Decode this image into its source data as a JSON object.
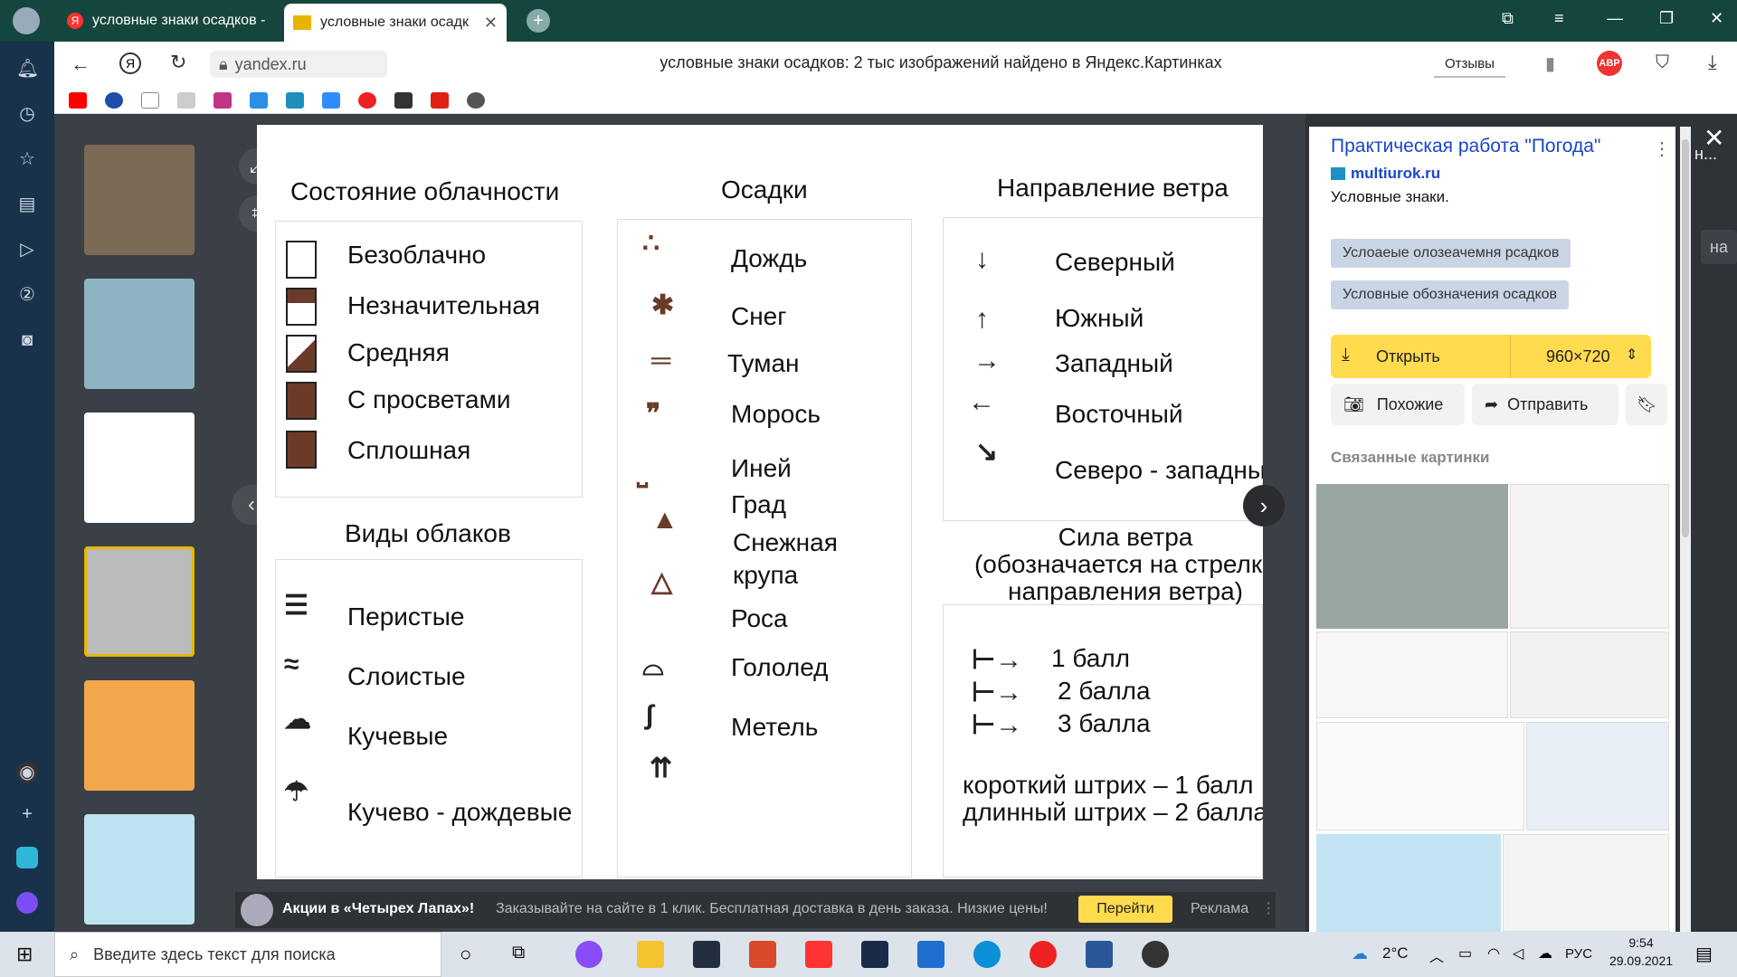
{
  "tabs": [
    {
      "label": "условные знаки осадков -"
    },
    {
      "label": "условные знаки осадк"
    }
  ],
  "address": {
    "domain": "yandex.ru",
    "page_title": "условные знаки осадков: 2 тыс изображений найдено в Яндекс.Картинках",
    "reviews": "Отзывы",
    "abp": "ABP"
  },
  "image": {
    "headings": {
      "clouds_state": "Состояние облачности",
      "precip": "Осадки",
      "wind_dir": "Направление ветра",
      "cloud_types": "Виды облаков",
      "wind_force": "Сила ветра",
      "wind_force_note1": "(обозначается на стрелке",
      "wind_force_note2": "направления ветра)"
    },
    "cloud_state": [
      "Безоблачно",
      "Незначительная",
      "Средняя",
      "С просветами",
      "Сплошная"
    ],
    "precip": [
      "Дождь",
      "Снег",
      "Туман",
      "Морось",
      "Иней",
      "Град",
      "Снежная",
      "крупа",
      "Роса",
      "Гололед",
      "Метель"
    ],
    "wind_dir": [
      "Северный",
      "Южный",
      "Западный",
      "Восточный",
      "Северо - западный"
    ],
    "cloud_types": [
      "Перистые",
      "Слоистые",
      "Кучевые",
      "Кучево - дождевые"
    ],
    "force": [
      "1 балл",
      "2 балла",
      "3 балла"
    ],
    "force_note1": "короткий штрих – 1 балл",
    "force_note2": "длинный штрих – 2 балла"
  },
  "right": {
    "title": "Практическая работа \"Погода\"",
    "source": "multiurok.ru",
    "desc": "Условные знаки.",
    "tag1": "Услоаеые олозеачемня рсадков",
    "tag2": "Условные обозначения осадков",
    "open": "Открыть",
    "size": "960×720",
    "similar": "Похожие",
    "send": "Отправить",
    "related": "Связанные картинки",
    "edge_text": "н...",
    "edge_text2": "на"
  },
  "ad": {
    "title": "Акции в «Четырех Лапах»!",
    "text": "Заказывайте на сайте в 1 клик. Бесплатная доставка в день заказа. Низкие цены!",
    "button": "Перейти",
    "label": "Реклама"
  },
  "taskbar": {
    "search": "Введите здесь текст для поиска",
    "temp": "2°C",
    "lang": "РУС",
    "time": "9:54",
    "date": "29.09.2021"
  },
  "colors": {
    "titlebar": "#15463d",
    "accent": "#ffdb4d",
    "link": "#1a46c8",
    "symbol": "#6b3b2a"
  }
}
